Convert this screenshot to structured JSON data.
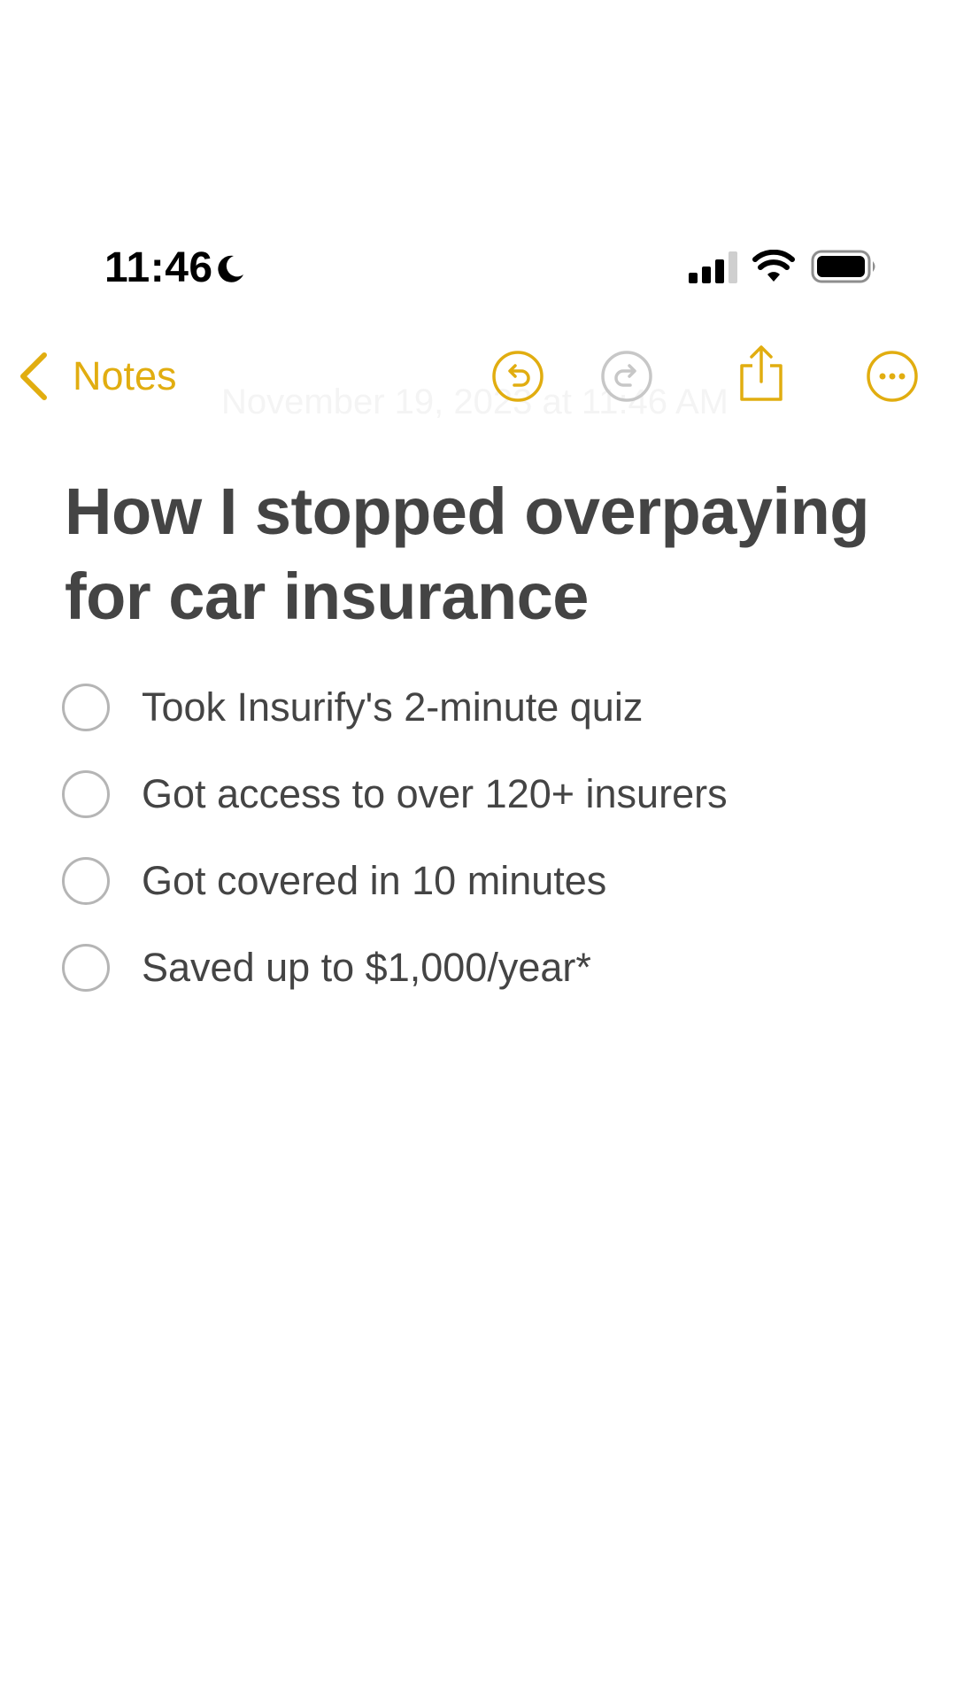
{
  "status_bar": {
    "time": "11:46",
    "icons": [
      "moon-icon",
      "cellular-signal-icon",
      "wifi-icon",
      "battery-icon"
    ]
  },
  "nav": {
    "back_label": "Notes",
    "icons": [
      "chevron-left-icon",
      "undo-icon",
      "redo-icon",
      "share-icon",
      "more-icon"
    ]
  },
  "note": {
    "date_faded": "November 19, 2023 at 11:46 AM",
    "title": "How I stopped overpaying for car insurance",
    "checklist": [
      {
        "text": "Took Insurify's 2-minute quiz",
        "checked": false
      },
      {
        "text": "Got access to over 120+ insurers",
        "checked": false
      },
      {
        "text": "Got covered in 10 minutes",
        "checked": false
      },
      {
        "text": "Saved up to $1,000/year*",
        "checked": false
      }
    ]
  },
  "colors": {
    "accent": "#e1ad10",
    "text": "#444444",
    "disabled_icon": "#c7c7c7",
    "checkbox_border": "#b5b5b5",
    "background": "#ffffff"
  }
}
